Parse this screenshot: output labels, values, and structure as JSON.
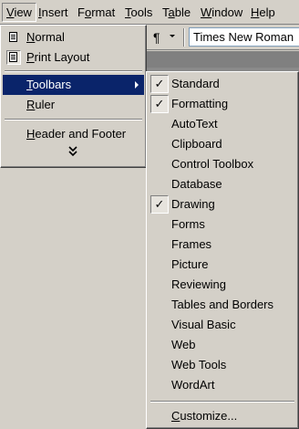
{
  "menubar": {
    "items": [
      {
        "label": "View",
        "open": true
      },
      {
        "label": "Insert"
      },
      {
        "label": "Format"
      },
      {
        "label": "Tools"
      },
      {
        "label": "Table"
      },
      {
        "label": "Window"
      },
      {
        "label": "Help"
      }
    ]
  },
  "toolbar": {
    "paragraph_symbol": "¶",
    "font_name": "Times New Roman"
  },
  "view_menu": {
    "items": [
      {
        "label": "Normal",
        "icon": "normal-view-icon"
      },
      {
        "label": "Print Layout",
        "icon": "print-layout-icon",
        "active": true
      },
      {
        "label": "Toolbars",
        "has_submenu": true,
        "highlighted": true
      },
      {
        "label": "Ruler"
      },
      {
        "label": "Header and Footer"
      }
    ],
    "expand_glyph": "»"
  },
  "toolbars_menu": {
    "items": [
      {
        "label": "Standard",
        "checked": true
      },
      {
        "label": "Formatting",
        "checked": true
      },
      {
        "label": "AutoText",
        "checked": false
      },
      {
        "label": "Clipboard",
        "checked": false
      },
      {
        "label": "Control Toolbox",
        "checked": false
      },
      {
        "label": "Database",
        "checked": false
      },
      {
        "label": "Drawing",
        "checked": true
      },
      {
        "label": "Forms",
        "checked": false
      },
      {
        "label": "Frames",
        "checked": false
      },
      {
        "label": "Picture",
        "checked": false
      },
      {
        "label": "Reviewing",
        "checked": false
      },
      {
        "label": "Tables and Borders",
        "checked": false
      },
      {
        "label": "Visual Basic",
        "checked": false
      },
      {
        "label": "Web",
        "checked": false
      },
      {
        "label": "Web Tools",
        "checked": false
      },
      {
        "label": "WordArt",
        "checked": false
      }
    ],
    "customize_label": "Customize...",
    "check_glyph": "✓"
  },
  "colors": {
    "face": "#d4d0c8",
    "highlight": "#0a246a",
    "shadow": "#808080"
  }
}
